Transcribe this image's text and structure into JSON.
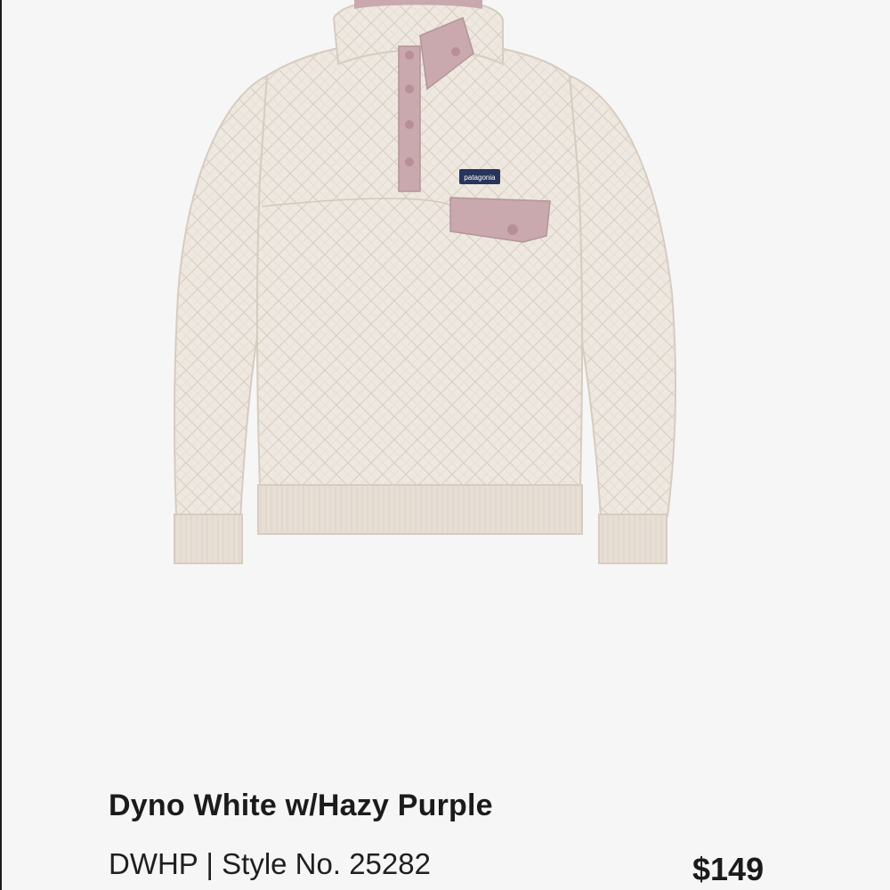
{
  "product": {
    "image_alt": "quilted snap-t pullover",
    "brand_logo_text": "patagonia",
    "color_name": "Dyno White w/Hazy Purple",
    "meta_line": "DWHP | Style No. 25282",
    "price": "$149"
  },
  "colors": {
    "body": "#ede6dd",
    "accent": "#c9a9ad",
    "rib": "#e6ddd3",
    "text": "#1b1b1b",
    "background": "#f6f6f6"
  }
}
